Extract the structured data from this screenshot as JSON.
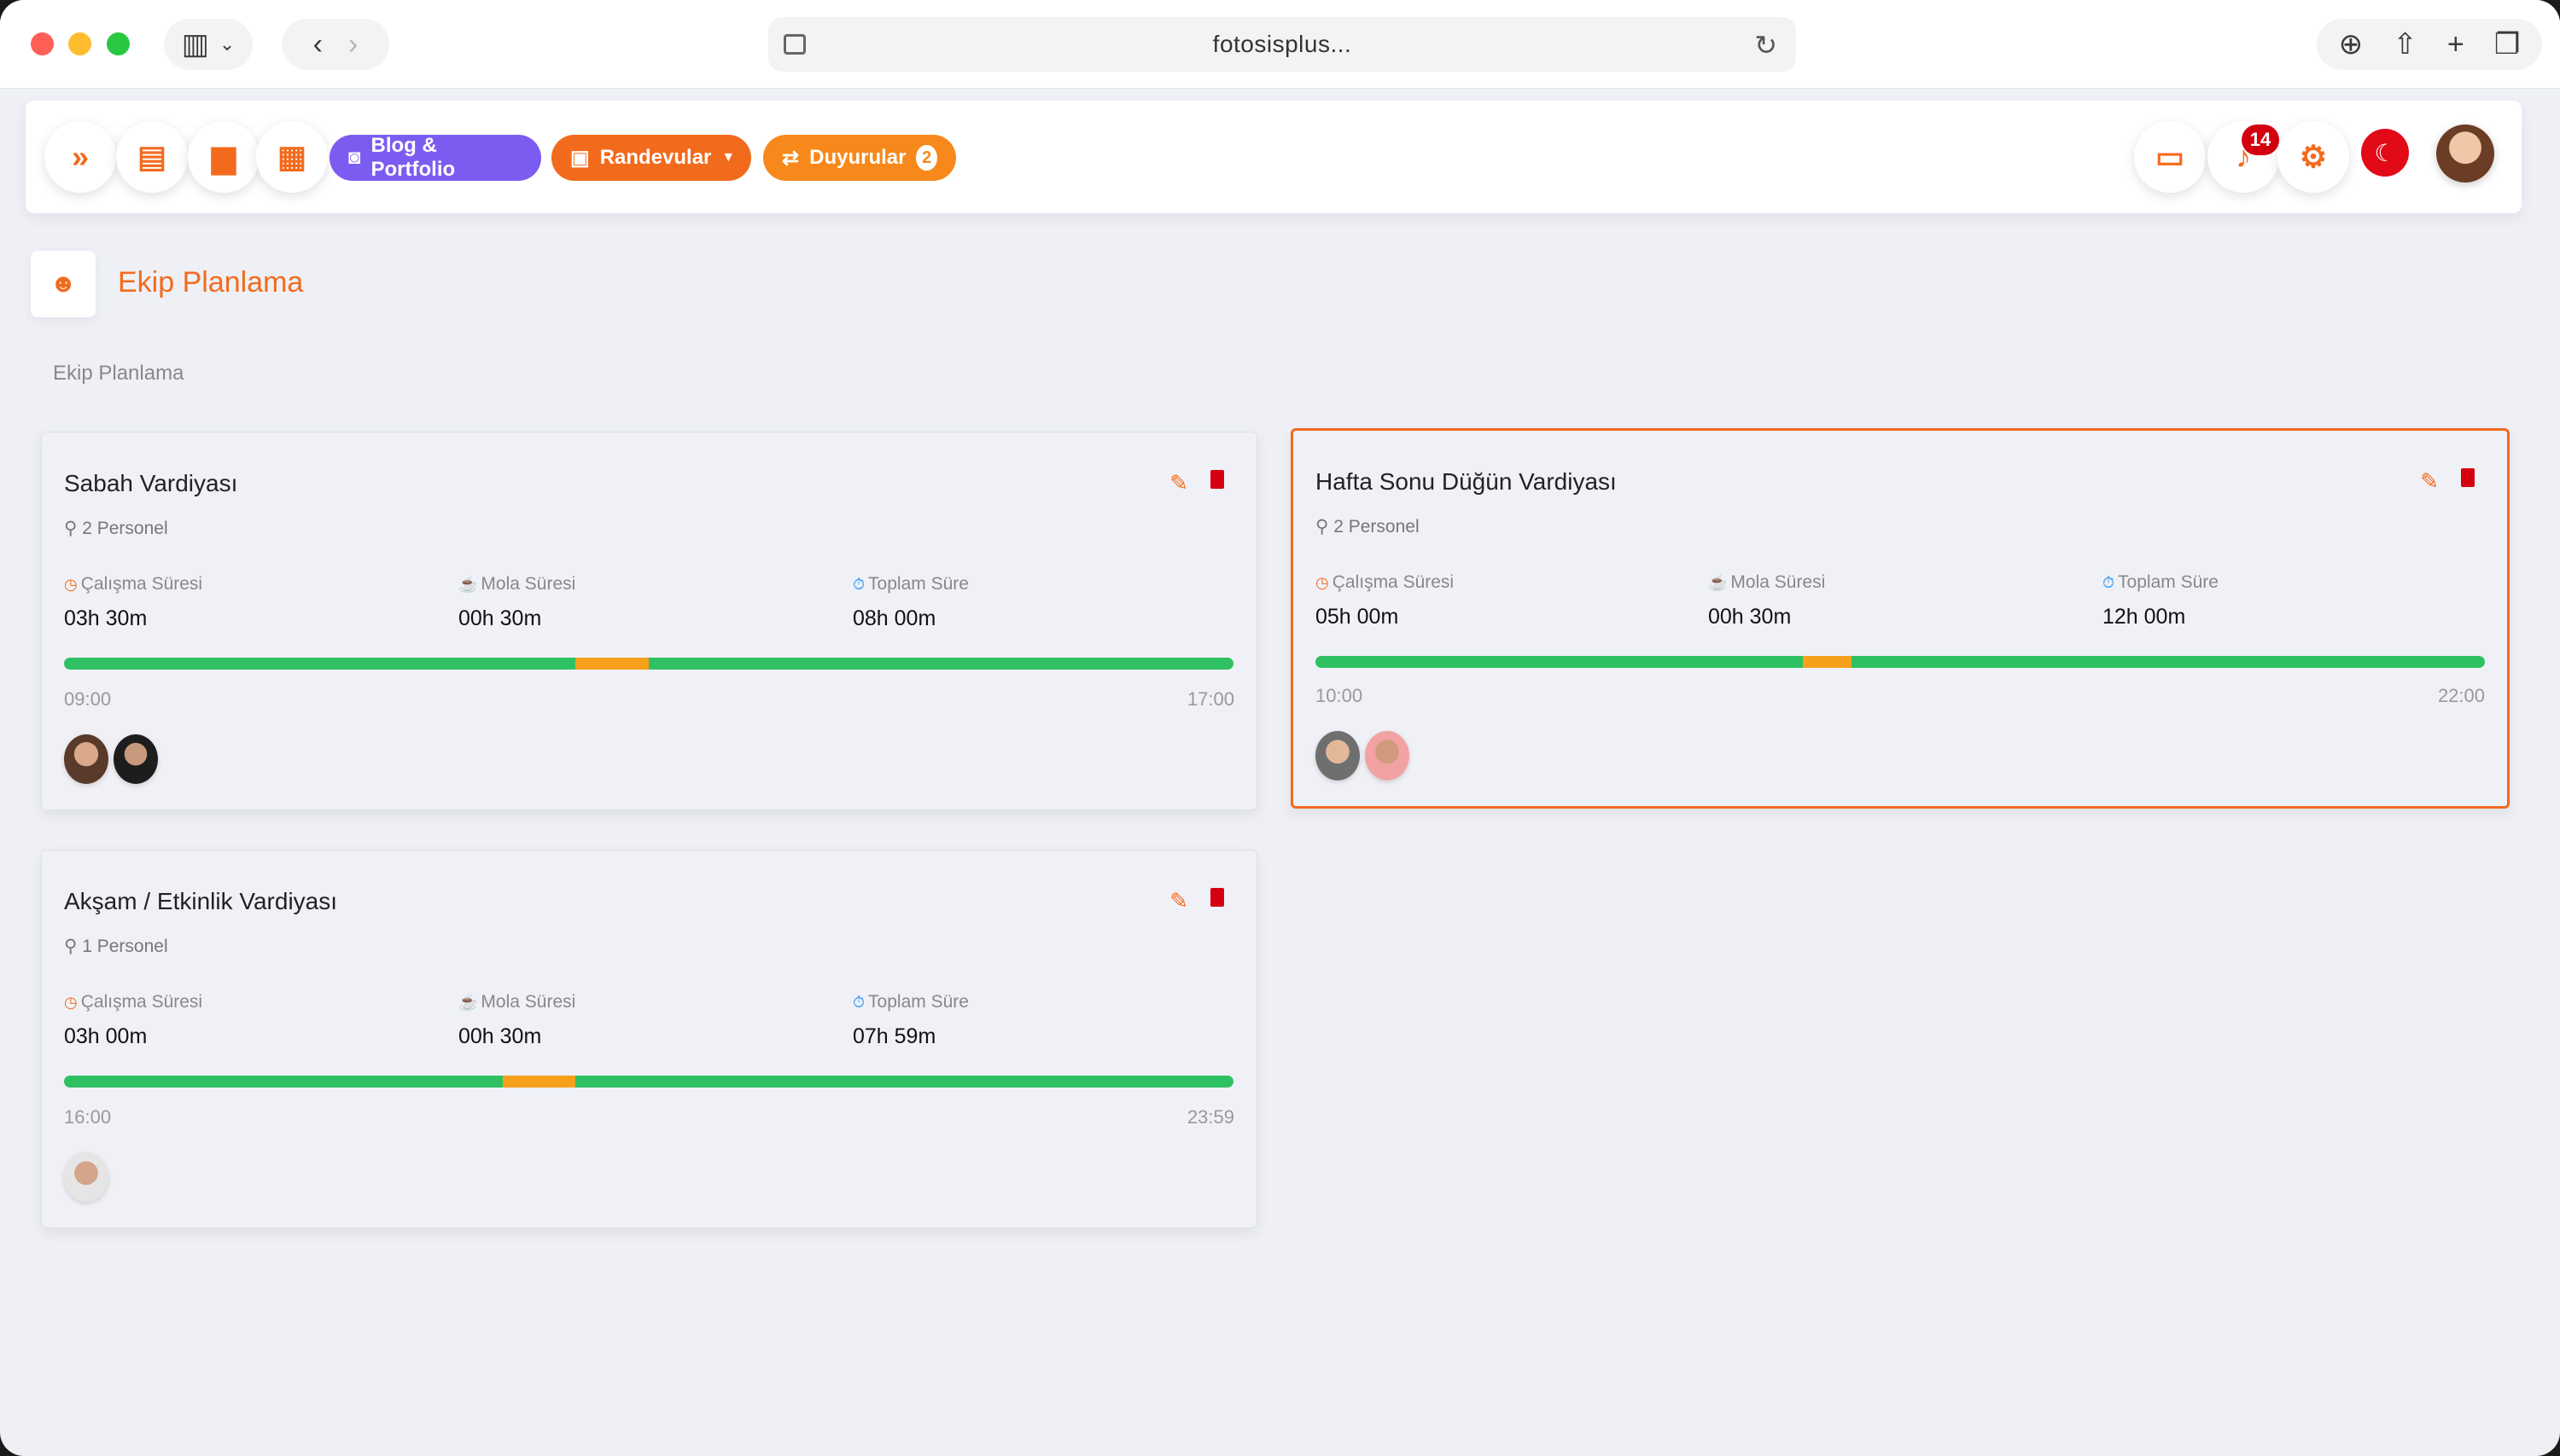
{
  "browser": {
    "address": "fotosisplus..."
  },
  "topbar": {
    "chips": {
      "blog": "Blog & Portfolio",
      "randevular": "Randevular",
      "duyurular": "Duyurular",
      "duyurular_count": "2"
    },
    "notifications_count": "14",
    "language_flag": "☾"
  },
  "page": {
    "title": "Ekip Planlama",
    "breadcrumb": "Ekip Planlama"
  },
  "labels": {
    "work": "Çalışma Süresi",
    "break": "Mola Süresi",
    "total": "Toplam Süre"
  },
  "shifts": [
    {
      "title": "Sabah Vardiyası",
      "personnel": "2 Personel",
      "work": "03h 30m",
      "break": "00h 30m",
      "total": "08h 00m",
      "start": "09:00",
      "end": "17:00",
      "break_start_fraction": 0.4375,
      "break_end_fraction": 0.5,
      "selected": false
    },
    {
      "title": "Hafta Sonu Düğün Vardiyası",
      "personnel": "2 Personel",
      "work": "05h 00m",
      "break": "00h 30m",
      "total": "12h 00m",
      "start": "10:00",
      "end": "22:00",
      "break_start_fraction": 0.4167,
      "break_end_fraction": 0.4583,
      "selected": true
    },
    {
      "title": "Akşam / Etkinlik Vardiyası",
      "personnel": "1 Personel",
      "work": "03h 00m",
      "break": "00h 30m",
      "total": "07h 59m",
      "start": "16:00",
      "end": "23:59",
      "break_start_fraction": 0.375,
      "break_end_fraction": 0.4375,
      "selected": false
    }
  ],
  "colors": {
    "accent": "#f26b1d",
    "work_bar": "#2fc161",
    "break_bar": "#f7a01c",
    "blog_chip": "#7c5cf0"
  }
}
